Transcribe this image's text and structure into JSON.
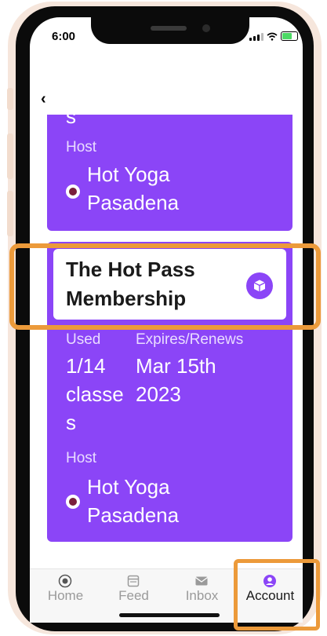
{
  "status_bar": {
    "time": "6:00"
  },
  "navigation": {
    "back_glyph": "‹"
  },
  "top_card": {
    "partial_text": "s",
    "host_label": "Host",
    "host_name_line1": "Hot Yoga",
    "host_name_line2": "Pasadena"
  },
  "membership_card": {
    "title_line1": "The Hot Pass",
    "title_line2": "Membership",
    "used_label": "Used",
    "used_line1": "1/14",
    "used_line2": "classe",
    "used_line3": "s",
    "expires_label": "Expires/Renews",
    "expires_line1": "Mar 15th",
    "expires_line2": "2023",
    "host_label": "Host",
    "host_name_line1": "Hot Yoga",
    "host_name_line2": "Pasadena"
  },
  "tabs": [
    {
      "label": "Home",
      "icon": "home-icon"
    },
    {
      "label": "Feed",
      "icon": "feed-icon"
    },
    {
      "label": "Inbox",
      "icon": "inbox-icon"
    },
    {
      "label": "Account",
      "icon": "account-icon",
      "active": true
    }
  ],
  "colors": {
    "accent": "#8b45f7",
    "highlight": "#ec9a3a",
    "tab_inactive": "#9a9a9a",
    "tab_active": "#1a1a1a"
  }
}
